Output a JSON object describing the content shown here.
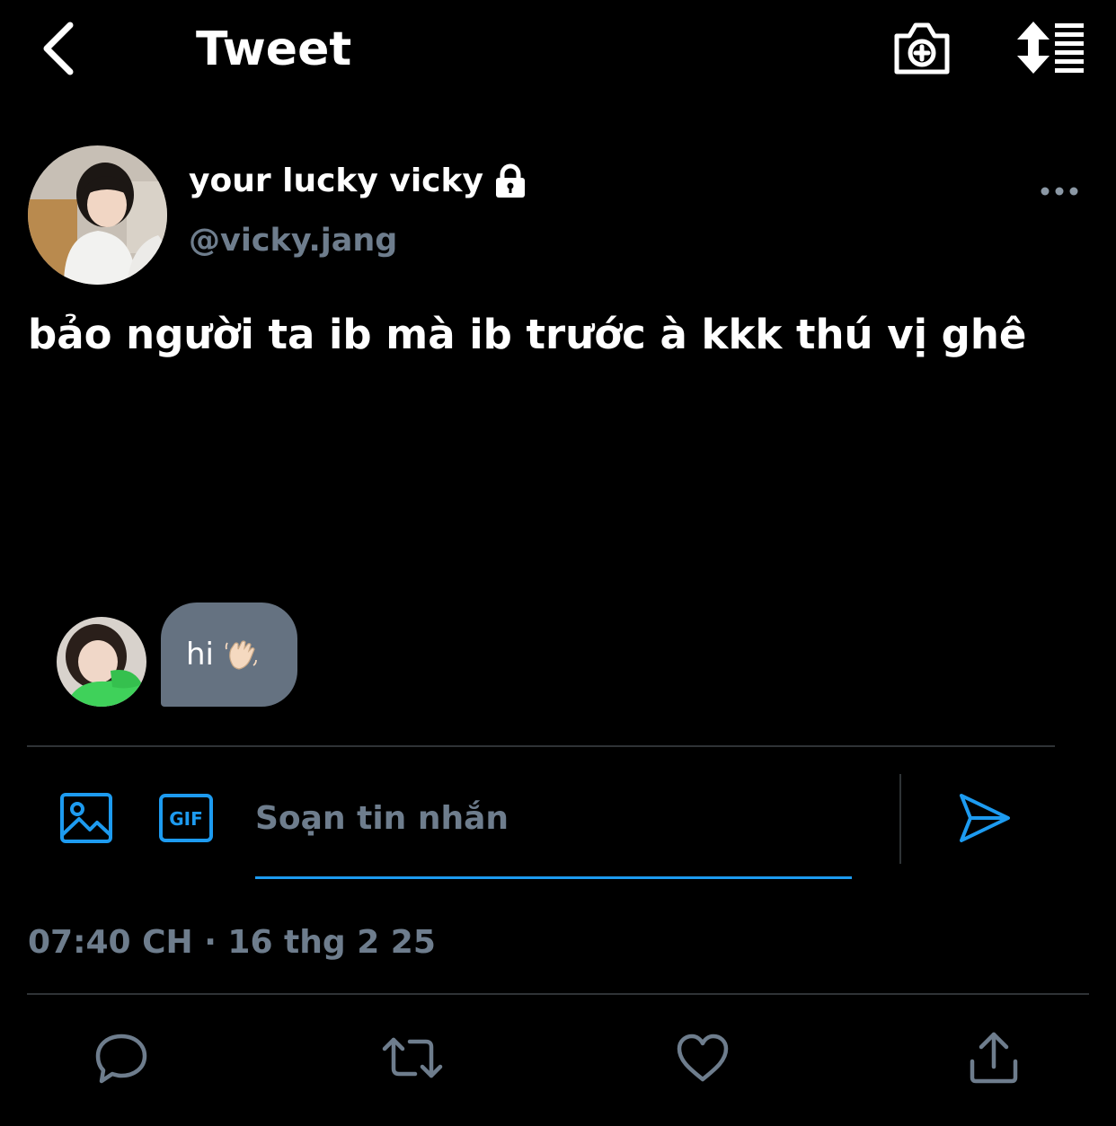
{
  "header": {
    "title": "Tweet",
    "icons": [
      "back-chevron-icon",
      "camera-plus-icon",
      "sort-icon"
    ]
  },
  "author": {
    "display_name": "your lucky vicky",
    "handle": "@vicky.jang",
    "protected_icon": "lock-icon",
    "more_icon": "more-horizontal-icon"
  },
  "tweet": {
    "text": "bảo người ta ib mà ib trước à kkk thú vị ghê"
  },
  "chat": {
    "message": "hi",
    "emoji_icon": "waving-hand-icon"
  },
  "composer": {
    "placeholder": "Soạn tin nhắn",
    "value": "",
    "media_icon": "image-icon",
    "gif_icon": "gif-icon",
    "send_icon": "send-icon"
  },
  "timestamp": "07:40 CH · 16 thg 2 25",
  "actions": [
    "reply-icon",
    "retweet-icon",
    "like-icon",
    "share-icon"
  ],
  "colors": {
    "background": "#000000",
    "accent": "#1d9bf0",
    "muted_text": "#6e7d8d",
    "bubble": "#657281",
    "divider": "#2f3336"
  }
}
